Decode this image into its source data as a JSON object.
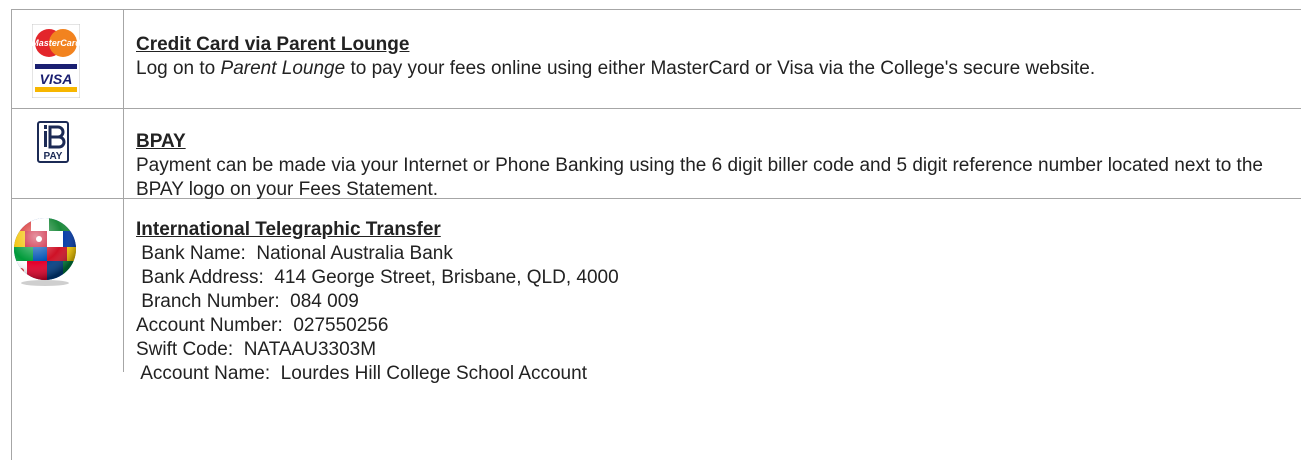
{
  "rows": [
    {
      "title": "Credit Card via Parent Lounge",
      "body_pre": "Log on to ",
      "body_em": "Parent Lounge",
      "body_post": " to pay your fees online using either MasterCard or Visa via the College's secure website.",
      "logo": {
        "icon": "mastercard-visa-icon",
        "line1": "MasterCard",
        "line2": "VISA"
      }
    },
    {
      "title": "BPAY",
      "body": "Payment can be made via your Internet or Phone Banking using the 6 digit biller code and 5 digit reference number located next to the BPAY logo on your Fees Statement.",
      "logo": {
        "icon": "bpay-icon",
        "label": "PAY"
      }
    },
    {
      "title": "International Telegraphic Transfer",
      "logo": {
        "icon": "globe-flags-icon"
      },
      "details": [
        " Bank Name:  National Australia Bank",
        " Bank Address:  414 George Street, Brisbane, QLD, 4000",
        " Branch Number:  084 009",
        "Account Number:  027550256",
        "Swift Code:  NATAAU3303M",
        " Account Name:  Lourdes Hill College School Account"
      ]
    }
  ],
  "colors": {
    "border": "#a6a6a6",
    "mastercard_red": "#e3262b",
    "mastercard_orange": "#f7a21b",
    "visa_blue": "#1a1f71",
    "visa_gold": "#f7b600",
    "bpay_navy": "#1b2a55"
  }
}
